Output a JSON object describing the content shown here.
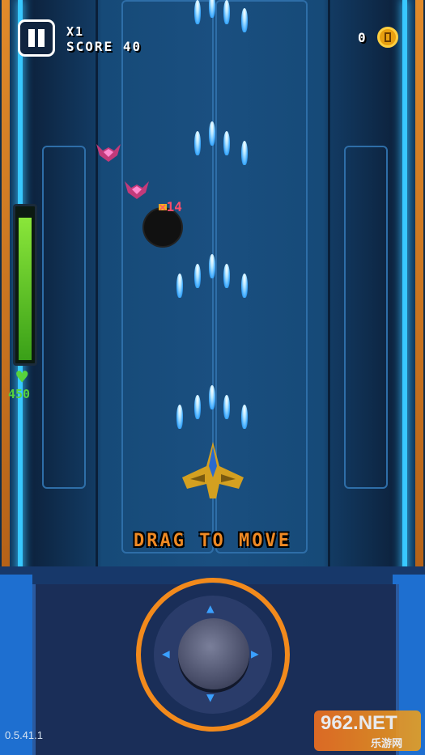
{
  "hud": {
    "multiplier": "X1",
    "score_label": "SCORE",
    "score_value": "40",
    "coins": "0",
    "health_value": "450",
    "health_fraction": 0.95
  },
  "combat": {
    "damage_text": "14"
  },
  "hint": "DRAG TO MOVE",
  "footer": {
    "version": "0.5.41.1"
  },
  "watermark": {
    "brand": "962.NET",
    "sub": "乐游网"
  },
  "colors": {
    "accent_orange": "#f28a1c",
    "health_green": "#57d43c",
    "bullet_blue": "#3aa8ff",
    "damage_red": "#ff4d6a"
  },
  "icons": {
    "pause": "pause-icon",
    "coin": "coin-icon",
    "heart": "heart-icon",
    "joystick": "joystick-icon"
  }
}
